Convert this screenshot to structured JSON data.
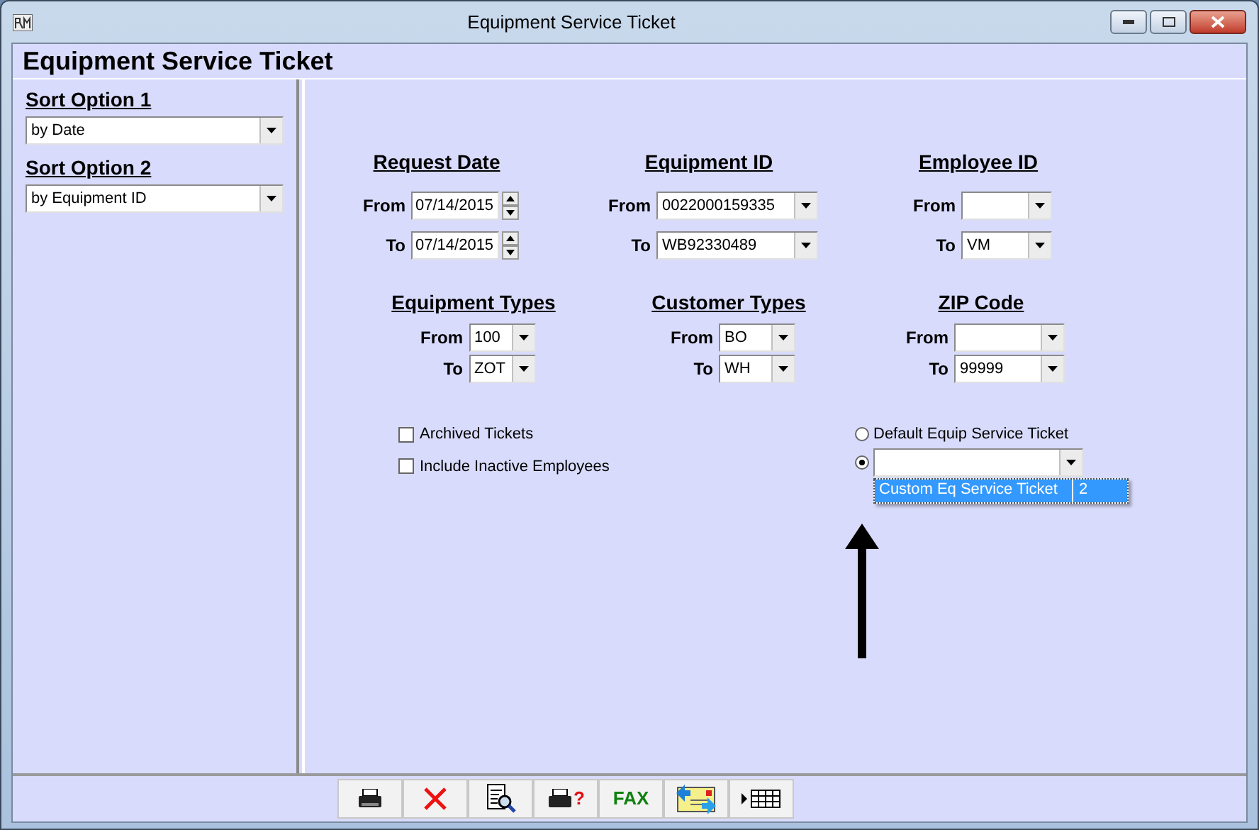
{
  "window": {
    "title": "Equipment Service Ticket"
  },
  "heading": "Equipment Service Ticket",
  "sort_options": [
    {
      "label": "Sort Option 1",
      "value": "by Date"
    },
    {
      "label": "Sort Option 2",
      "value": "by Equipment ID"
    }
  ],
  "filters": [
    {
      "title": "Request Date",
      "kind": "spin",
      "from": {
        "label": "From",
        "value": "07/14/2015"
      },
      "to": {
        "label": "To",
        "value": "07/14/2015"
      }
    },
    {
      "title": "Equipment ID",
      "kind": "combo",
      "from": {
        "label": "From",
        "value": "0022000159335"
      },
      "to": {
        "label": "To",
        "value": "WB92330489"
      }
    },
    {
      "title": "Employee ID",
      "kind": "combo",
      "from": {
        "label": "From"
      },
      "to": {
        "label": "To",
        "value": "VM"
      }
    },
    {
      "title": "Equipment Types",
      "kind": "combo",
      "from": {
        "label": "From",
        "value": "100"
      },
      "to": {
        "label": "To",
        "value": "ZOT"
      }
    },
    {
      "title": "Customer Types",
      "kind": "combo",
      "from": {
        "label": "From",
        "value": "BO"
      },
      "to": {
        "label": "To",
        "value": "WH"
      }
    },
    {
      "title": "ZIP Code",
      "kind": "combo",
      "from": {
        "label": "From"
      },
      "to": {
        "label": "To",
        "value": "99999"
      }
    }
  ],
  "checkboxes": [
    {
      "label": "Archived Tickets",
      "checked": false
    },
    {
      "label": "Include Inactive Employees",
      "checked": false
    }
  ],
  "report_options": [
    {
      "kind": "label",
      "label": "Default Equip Service Ticket",
      "selected": false
    },
    {
      "kind": "combo",
      "selected": true
    }
  ],
  "dropdown_list": [
    {
      "name": "Custom Eq Service Ticket",
      "column_2": "2",
      "selected": true
    }
  ],
  "toolbar": [
    {
      "kind": "print"
    },
    {
      "kind": "cancel"
    },
    {
      "kind": "preview"
    },
    {
      "kind": "print-setup",
      "label": "?"
    },
    {
      "kind": "fax",
      "label": "FAX"
    },
    {
      "kind": "email"
    },
    {
      "kind": "grid"
    }
  ]
}
